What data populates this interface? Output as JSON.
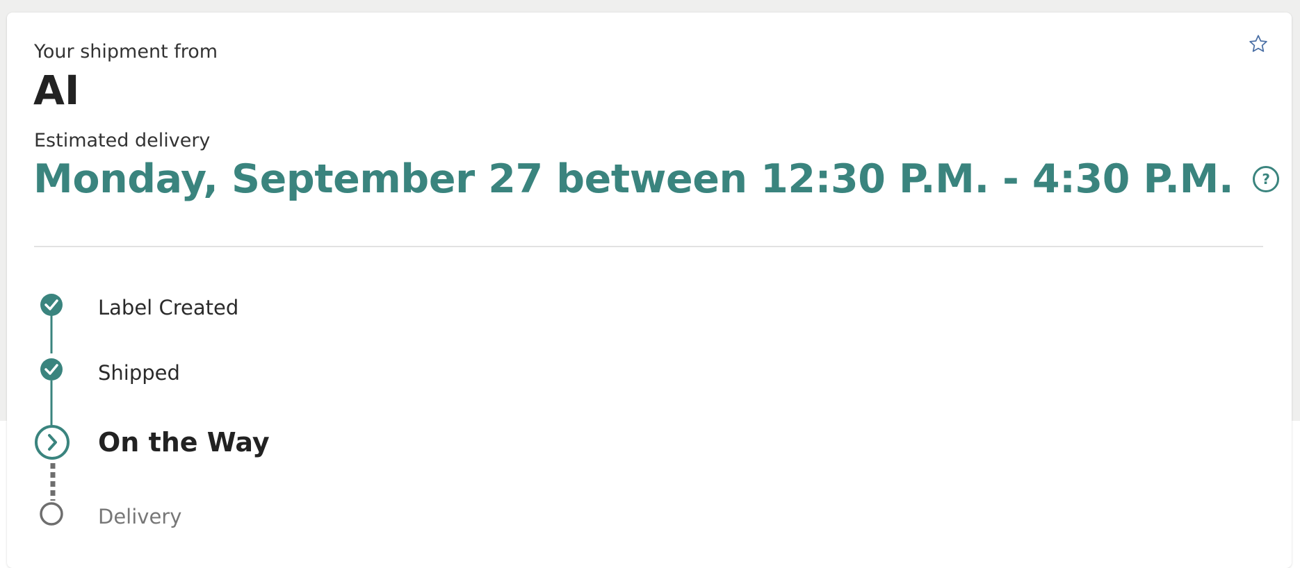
{
  "header": {
    "from_label": "Your shipment from",
    "shipper_name": "AI",
    "estimated_label": "Estimated delivery",
    "estimated_value": "Monday, September 27 between 12:30 P.M. - 4:30 P.M.",
    "help_glyph": "?",
    "favorite_icon": "star-outline-icon",
    "help_icon": "question-circle-icon"
  },
  "timeline": {
    "steps": [
      {
        "label": "Label Created",
        "status": "completed",
        "icon": "check-circle-icon"
      },
      {
        "label": "Shipped",
        "status": "completed",
        "icon": "check-circle-icon"
      },
      {
        "label": "On the Way",
        "status": "current",
        "icon": "chevron-right-circle-icon"
      },
      {
        "label": "Delivery",
        "status": "pending",
        "icon": "empty-circle-icon"
      }
    ]
  },
  "colors": {
    "accent": "#3a847e",
    "text_primary": "#222222",
    "text_muted": "#777777",
    "star_icon": "#4a6fa5",
    "page_background": "#efefee"
  }
}
